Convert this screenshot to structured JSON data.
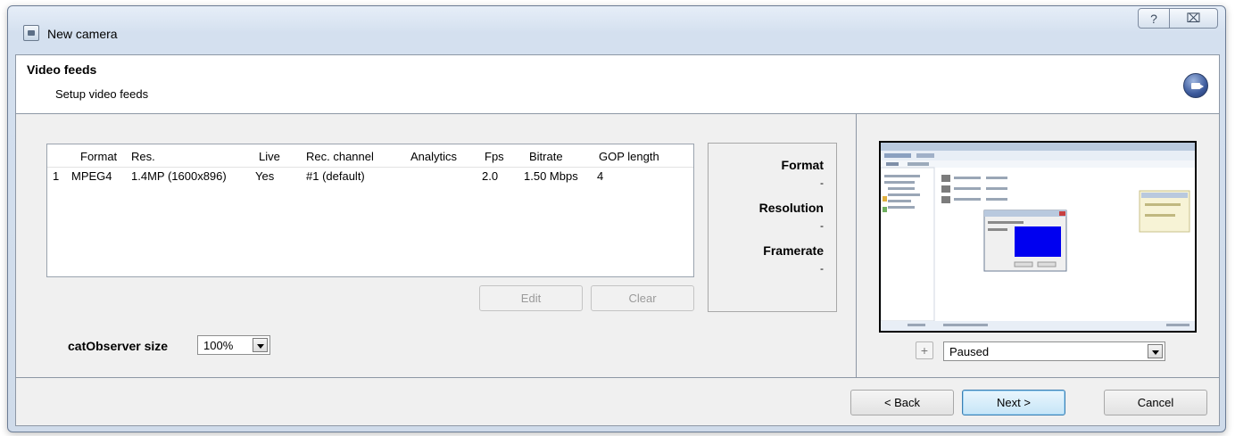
{
  "window": {
    "title": "New camera",
    "help_glyph": "?",
    "close_glyph": "⌧"
  },
  "header": {
    "title": "Video feeds",
    "subtitle": "Setup video feeds",
    "icon": "camera-icon"
  },
  "feeds_table": {
    "columns": [
      "",
      "Format",
      "Res.",
      "Live",
      "Rec. channel",
      "Analytics",
      "Fps",
      "Bitrate",
      "GOP length"
    ],
    "rows": [
      [
        "1",
        "MPEG4",
        "1.4MP (1600x896)",
        "Yes",
        "#1 (default)",
        "",
        "2.0",
        "1.50 Mbps",
        "4"
      ]
    ]
  },
  "table_buttons": {
    "edit": "Edit",
    "clear": "Clear"
  },
  "info_panel": {
    "format_label": "Format",
    "format_value": "-",
    "resolution_label": "Resolution",
    "resolution_value": "-",
    "framerate_label": "Framerate",
    "framerate_value": "-"
  },
  "size_option": {
    "label": "catObserver size",
    "value": "100%"
  },
  "preview": {
    "add_glyph": "+",
    "state": "Paused"
  },
  "footer": {
    "back": "< Back",
    "next": "Next >",
    "cancel": "Cancel"
  },
  "colors": {
    "client_bg": "#f0f0f0",
    "header_bg": "#ffffff",
    "default_button_border": "#3c7fb1",
    "preview_blue": "#0000f0"
  }
}
